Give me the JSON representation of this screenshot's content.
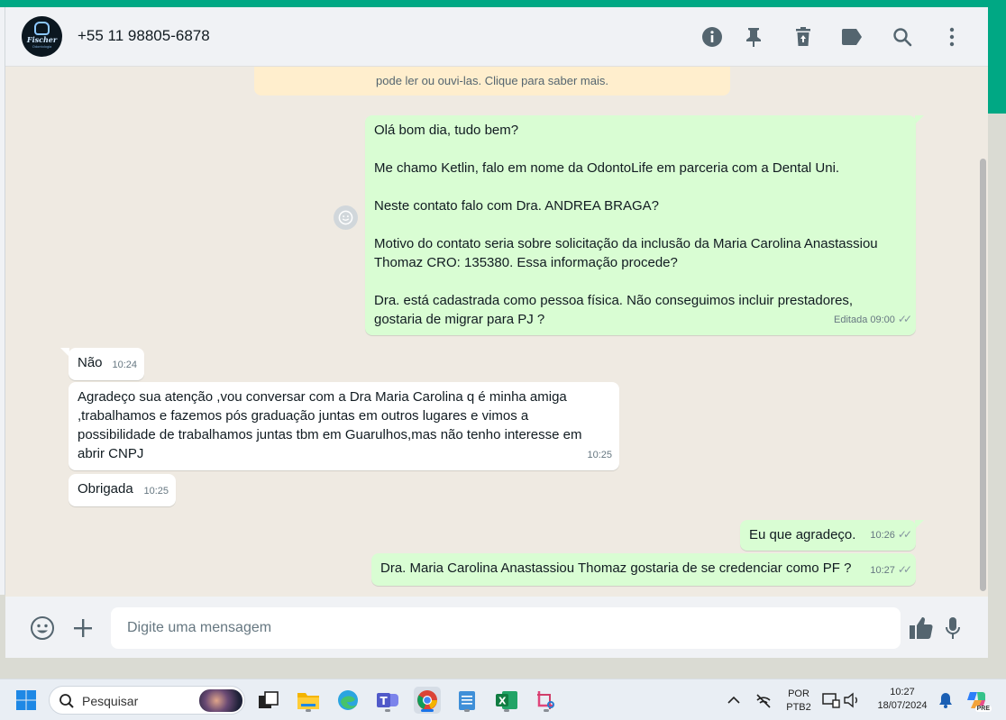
{
  "header": {
    "contact_name": "+55 11 98805-6878",
    "avatar": {
      "name": "Fischer",
      "sub": "Odontologia"
    },
    "icons": [
      "info-icon",
      "pin-icon",
      "delete-icon",
      "label-icon",
      "search-icon",
      "menu-icon"
    ]
  },
  "chat": {
    "notice_text": "pode ler ou ouvi-las. Clique para saber mais.",
    "messages": [
      {
        "direction": "out",
        "lines": [
          "Olá bom dia, tudo bem?",
          "",
          "Me chamo Ketlin, falo em nome da OdontoLife em parceria com a Dental Uni.",
          "",
          "Neste contato falo com Dra. ANDREA BRAGA?",
          "",
          "Motivo do contato seria sobre solicitação da inclusão da Maria Carolina Anastassiou",
          "Thomaz CRO: 135380. Essa informação procede?",
          "",
          "Dra. está cadastrada como pessoa física. Não conseguimos incluir prestadores,",
          "gostaria de migrar para PJ ?"
        ],
        "time": "Editada 09:00",
        "status": "read"
      },
      {
        "direction": "in",
        "lines": [
          "Não"
        ],
        "time": "10:24"
      },
      {
        "direction": "in",
        "lines": [
          "Agradeço sua atenção ,vou conversar com a Dra Maria Carolina q é minha amiga",
          ",trabalhamos e fazemos pós graduação juntas em outros lugares e vimos a",
          "possibilidade de trabalhamos juntas tbm em Guarulhos,mas não tenho interesse em",
          "abrir CNPJ"
        ],
        "time": "10:25"
      },
      {
        "direction": "in",
        "lines": [
          "Obrigada"
        ],
        "time": "10:25"
      },
      {
        "direction": "out",
        "lines": [
          "Eu que agradeço."
        ],
        "time": "10:26",
        "status": "read"
      },
      {
        "direction": "out",
        "lines": [
          "Dra. Maria Carolina Anastassiou Thomaz gostaria de se credenciar como PF ?"
        ],
        "time": "10:27",
        "status": "read"
      }
    ]
  },
  "composer": {
    "placeholder": "Digite uma mensagem"
  },
  "taskbar": {
    "search_label": "Pesquisar",
    "lang_line1": "POR",
    "lang_line2": "PTB2",
    "clock_time": "10:27",
    "clock_date": "18/07/2024",
    "copilot_badge": "PRE"
  },
  "colors": {
    "accent": "#00a884",
    "outgoing_bubble": "#d9fdd3",
    "incoming_bubble": "#ffffff",
    "chat_bg": "#efeae2",
    "notice_bg": "#ffeecd"
  }
}
